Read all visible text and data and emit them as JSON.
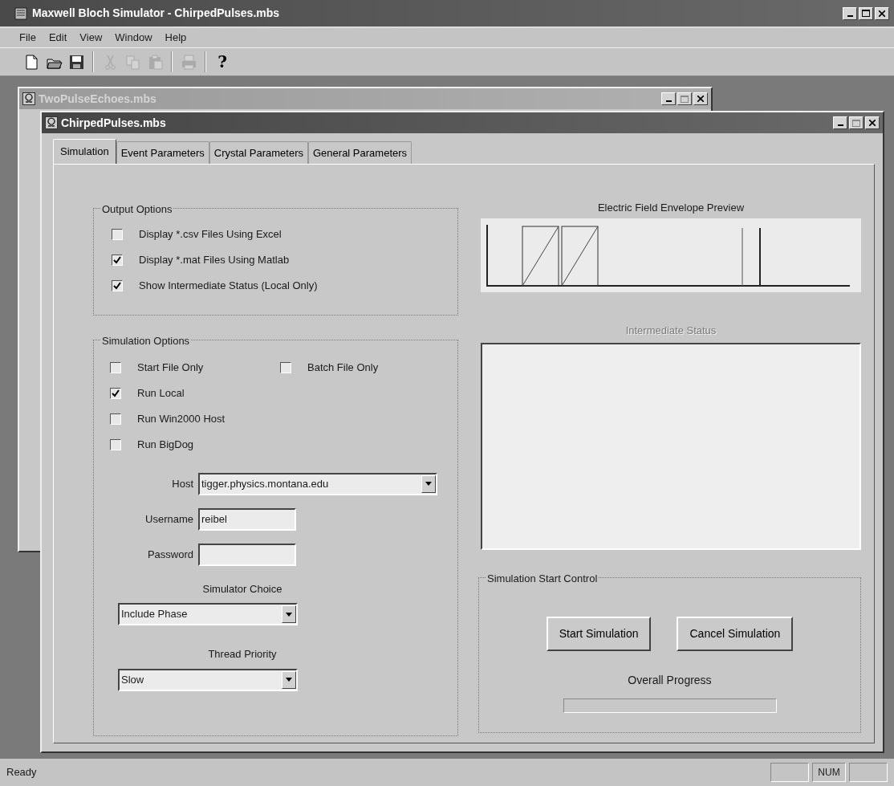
{
  "window": {
    "title": "Maxwell Bloch Simulator - ChirpedPulses.mbs"
  },
  "menu": [
    "File",
    "Edit",
    "View",
    "Window",
    "Help"
  ],
  "toolbar": [
    {
      "kind": "new",
      "disabled": false
    },
    {
      "kind": "open",
      "disabled": false
    },
    {
      "kind": "save",
      "disabled": false
    },
    {
      "kind": "cut",
      "disabled": true
    },
    {
      "kind": "copy",
      "disabled": true
    },
    {
      "kind": "paste",
      "disabled": true
    },
    {
      "kind": "print",
      "disabled": true
    },
    {
      "kind": "help",
      "disabled": false,
      "text": "?"
    }
  ],
  "documents": [
    {
      "title": "TwoPulseEchoes.mbs",
      "active": false
    },
    {
      "title": "ChirpedPulses.mbs",
      "active": true
    }
  ],
  "tabs": [
    {
      "label": "Simulation",
      "selected": true
    },
    {
      "label": "Event Parameters",
      "selected": false
    },
    {
      "label": "Crystal Parameters",
      "selected": false
    },
    {
      "label": "General Parameters",
      "selected": false
    }
  ],
  "output_options": {
    "title": "Output Options",
    "checkboxes": [
      {
        "label": "Display *.csv Files Using Excel",
        "checked": false
      },
      {
        "label": "Display *.mat Files Using Matlab",
        "checked": true
      },
      {
        "label": "Show Intermediate Status (Local Only)",
        "checked": true
      }
    ]
  },
  "simulation_options": {
    "title": "Simulation Options",
    "checkboxes": [
      {
        "label": "Start File Only",
        "checked": false
      },
      {
        "label": "Batch File Only",
        "checked": false
      },
      {
        "label": "Run Local",
        "checked": true
      },
      {
        "label": "Run Win2000 Host",
        "checked": false
      },
      {
        "label": "Run BigDog",
        "checked": false
      }
    ],
    "host": {
      "label": "Host",
      "value": "tigger.physics.montana.edu"
    },
    "username": {
      "label": "Username",
      "value": "reibel"
    },
    "password": {
      "label": "Password"
    },
    "simulator_choice": {
      "label": "Simulator Choice",
      "value": "Include Phase"
    },
    "thread_priority": {
      "label": "Thread Priority",
      "value": "Slow"
    }
  },
  "preview": {
    "title": "Electric Field Envelope  Preview"
  },
  "intermediate_status": {
    "label": "Intermediate Status",
    "disabled": true
  },
  "start_control": {
    "title": "Simulation Start Control",
    "buttons": [
      "Start Simulation",
      "Cancel Simulation"
    ],
    "progress_label": "Overall Progress",
    "level": 0
  },
  "status_bar": {
    "text": "Ready",
    "num_indicator": "NUM"
  }
}
